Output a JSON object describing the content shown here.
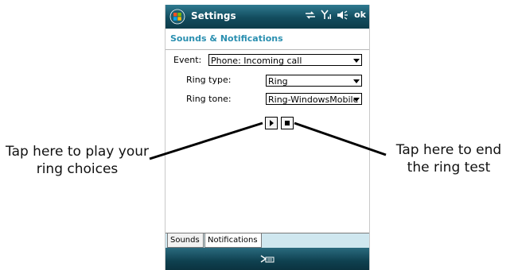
{
  "window": {
    "title": "Settings",
    "ok_label": "ok",
    "icons": [
      "windows-start-icon",
      "connectivity-icon",
      "signal-icon",
      "speaker-icon"
    ]
  },
  "page": {
    "title": "Sounds & Notifications"
  },
  "event": {
    "label": "Event:",
    "value": "Phone: Incoming call"
  },
  "ring_type": {
    "label": "Ring type:",
    "value": "Ring"
  },
  "ring_tone": {
    "label": "Ring tone:",
    "value": "Ring-WindowsMobile"
  },
  "tabs": [
    {
      "label": "Sounds"
    },
    {
      "label": "Notifications",
      "selected": true
    }
  ],
  "callouts": {
    "left": "Tap here to play your ring choices",
    "right": "Tap here to end the ring test"
  },
  "colors": {
    "titlebar": "#124c5e",
    "accent_text": "#2a8fb0",
    "tabstrip": "#cfe7ef"
  }
}
